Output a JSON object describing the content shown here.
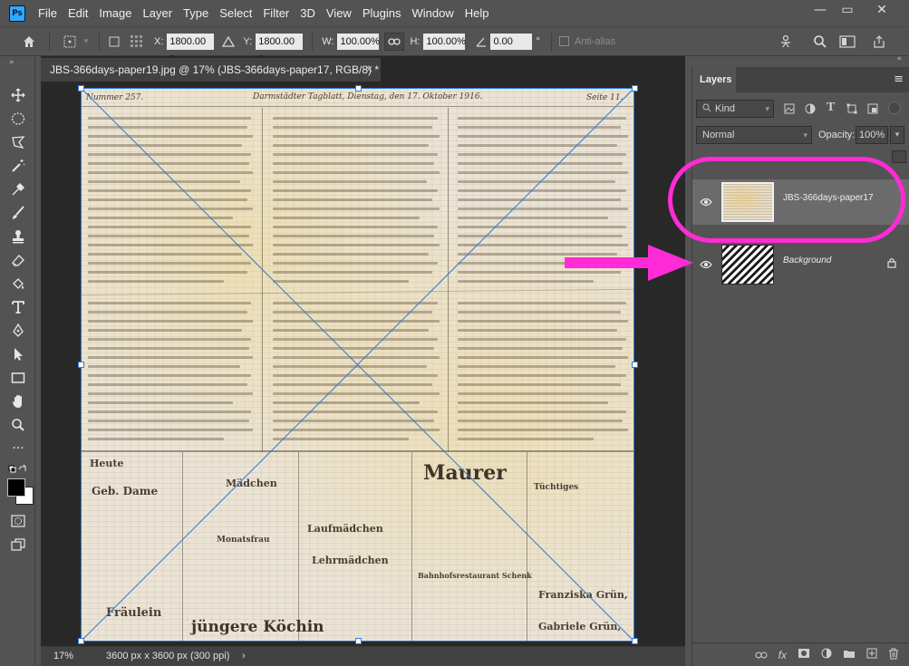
{
  "app": {
    "logo": "Ps"
  },
  "menu": [
    "File",
    "Edit",
    "Image",
    "Layer",
    "Type",
    "Select",
    "Filter",
    "3D",
    "View",
    "Plugins",
    "Window",
    "Help"
  ],
  "window_controls": {
    "minimize": "—",
    "maximize": "▭",
    "close": "✕"
  },
  "options_bar": {
    "x_label": "X:",
    "x_value": "1800.00 p",
    "y_label": "Y:",
    "y_value": "1800.00 p",
    "w_label": "W:",
    "w_value": "100.00%",
    "h_label": "H:",
    "h_value": "100.00%",
    "angle_value": "0.00",
    "angle_unit": "°",
    "antialias_label": "Anti-alias"
  },
  "document": {
    "tab_title": "JBS-366days-paper19.jpg @ 17% (JBS-366days-paper17, RGB/8) *",
    "tab_close": "✕",
    "zoom": "17%",
    "doc_info": "3600 px x 3600 px (300 ppi)",
    "status_arrow": "›",
    "paper_text_sample": [
      "Nummer 257.",
      "Darmstädter Tagblatt, Dienstag, den 17. Oktober 1916.",
      "Seite 11.",
      "Heute",
      "Geb. Dame",
      "Mädchen",
      "Maurer",
      "Fräulein",
      "jüngere Köchin",
      "Franziska Grün,",
      "Gabriele Grün,",
      "Tüchtiges",
      "Monatsfrau",
      "Lehrmädchen",
      "Bahnhofsrestaurant Schenk",
      "Laufmädchen"
    ]
  },
  "layers_panel": {
    "tab_label": "Layers",
    "menu_icon": "≡",
    "kind_label": "Kind",
    "blend_mode": "Normal",
    "opacity_label": "Opacity:",
    "opacity_value": "100%",
    "layers": [
      {
        "name": "JBS-366days-paper17",
        "visible": true,
        "selected": true,
        "locked": false
      },
      {
        "name": "Background",
        "visible": true,
        "selected": false,
        "locked": true
      }
    ],
    "bottom_icons": [
      "link-icon",
      "fx-icon",
      "mask-icon",
      "adjustment-icon",
      "folder-icon",
      "new-layer-icon",
      "trash-icon"
    ],
    "fx_label": "fx"
  },
  "annotations": {
    "highlight_color": "#ff2bd6",
    "arrow_color": "#ff2bd6"
  },
  "colors": {
    "ui_bg": "#535353",
    "canvas_bg": "#282828",
    "selection": "#2d7be0",
    "ps_blue": "#31a8ff"
  }
}
